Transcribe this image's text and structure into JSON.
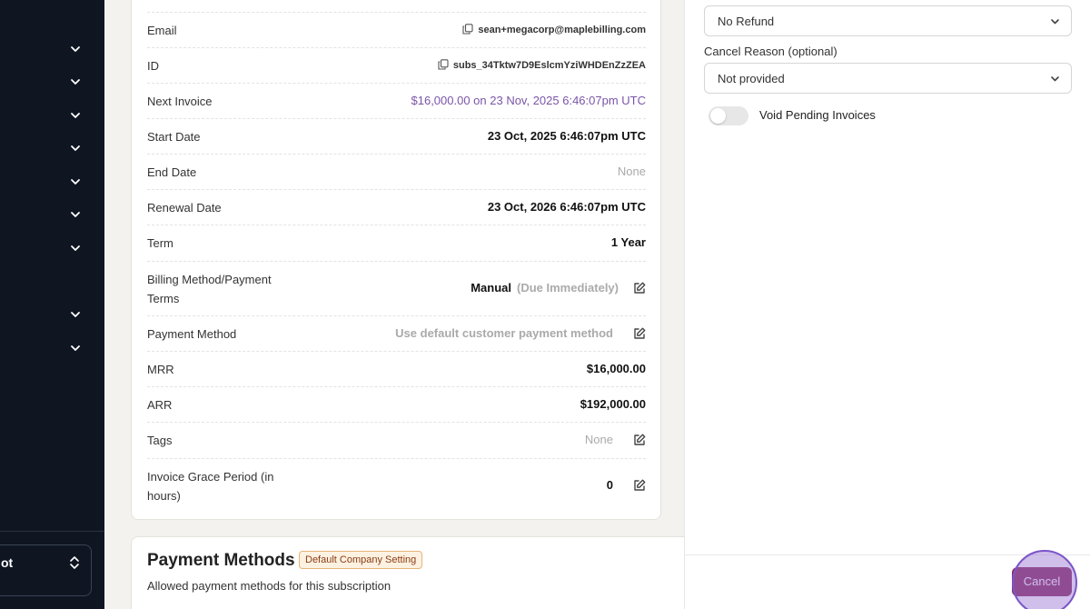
{
  "sidebar": {
    "chevron_count": 8,
    "switcher": {
      "label": "ot"
    }
  },
  "details": {
    "email": {
      "label": "Email",
      "value": "sean+megacorp@maplebilling.com"
    },
    "id": {
      "label": "ID",
      "value": "subs_34Tktw7D9EslcmYziWHDEnZzZEA"
    },
    "next_invoice": {
      "label": "Next Invoice",
      "value": "$16,000.00 on 23 Nov, 2025 6:46:07pm UTC"
    },
    "start_date": {
      "label": "Start Date",
      "value": "23 Oct, 2025 6:46:07pm UTC"
    },
    "end_date": {
      "label": "End Date",
      "value": "None"
    },
    "renewal_date": {
      "label": "Renewal Date",
      "value": "23 Oct, 2026 6:46:07pm UTC"
    },
    "term": {
      "label": "Term",
      "value": "1 Year"
    },
    "billing_method": {
      "label_line1": "Billing Method/Payment",
      "label_line2": "Terms",
      "value": "Manual",
      "qualifier": "(Due Immediately)"
    },
    "payment_method": {
      "label": "Payment Method",
      "value": "Use default customer payment method"
    },
    "mrr": {
      "label": "MRR",
      "value": "$16,000.00"
    },
    "arr": {
      "label": "ARR",
      "value": "$192,000.00"
    },
    "tags": {
      "label": "Tags",
      "value": "None"
    },
    "grace_period": {
      "label_line1": "Invoice Grace Period (in",
      "label_line2": "hours)",
      "value": "0"
    }
  },
  "payment_methods": {
    "title": "Payment Methods",
    "badge": "Default Company Setting",
    "subtitle": "Allowed payment methods for this subscription"
  },
  "cancel_panel": {
    "refund_select": {
      "value": "No Refund"
    },
    "cancel_reason": {
      "label": "Cancel Reason (optional)",
      "value": "Not provided"
    },
    "void_toggle": {
      "label": "Void Pending Invoices",
      "on": false
    },
    "cancel_button": "Cancel"
  },
  "colors": {
    "sidebar_bg": "#0f1622",
    "link": "#7a55a8",
    "cancel_button": "#8a3060",
    "badge_border": "#e8b37a"
  }
}
